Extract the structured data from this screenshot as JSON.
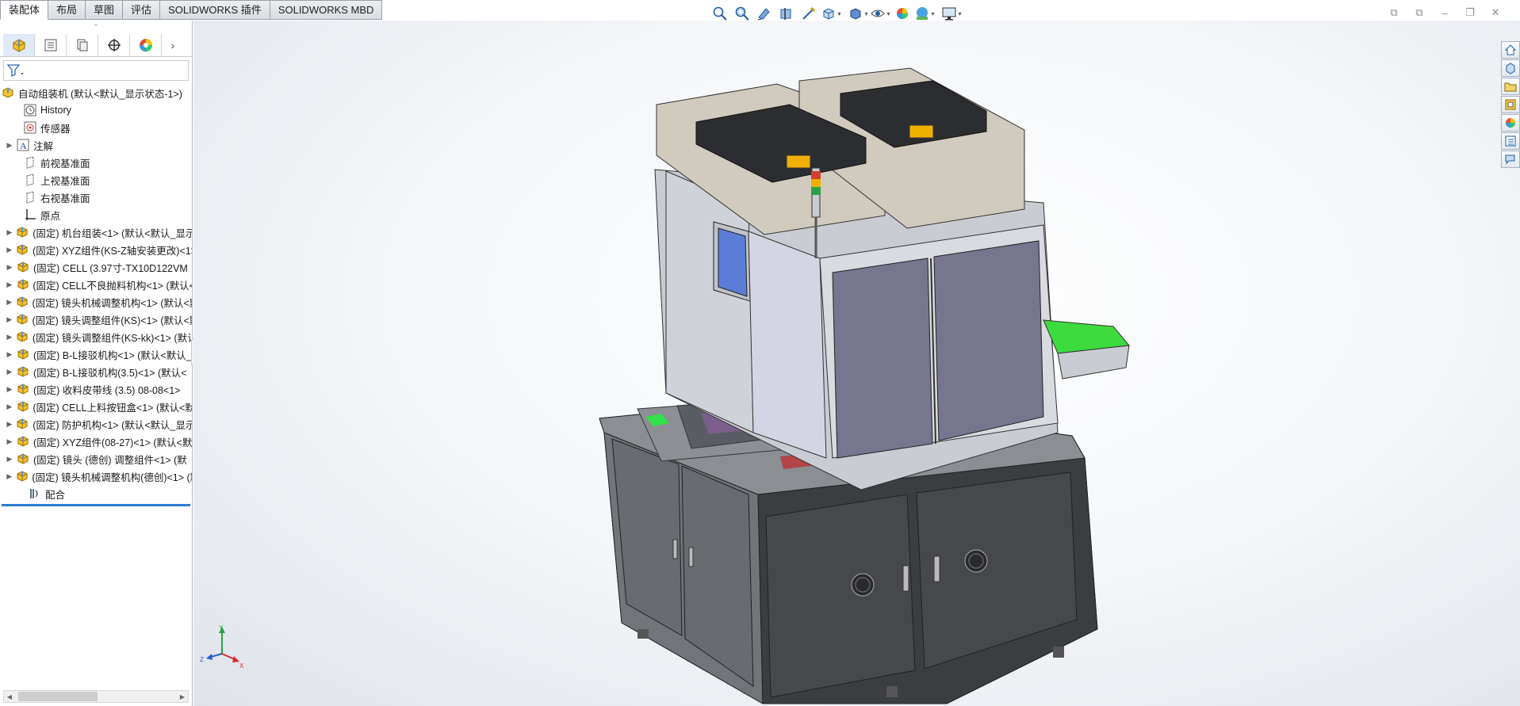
{
  "tabs": [
    "装配体",
    "布局",
    "草图",
    "评估",
    "SOLIDWORKS 插件",
    "SOLIDWORKS MBD"
  ],
  "active_tab_index": 0,
  "hud_icons": [
    "zoom-to-fit-icon",
    "zoom-to-area-icon",
    "previous-view-icon",
    "section-view-icon",
    "dynamic-annotation-icon",
    "view-orientation-icon",
    "display-style-icon",
    "hide-show-items-icon",
    "edit-appearance-icon",
    "apply-scene-icon",
    "view-settings-icon"
  ],
  "window_controls": [
    "tile-horizontal-icon",
    "tile-vertical-icon",
    "minimize-icon",
    "restore-icon",
    "close-icon"
  ],
  "panel_tabs": [
    "featuremanager-tab-icon",
    "propertymanager-tab-icon",
    "configurationmanager-tab-icon",
    "dimxpert-tab-icon",
    "displaymanager-tab-icon"
  ],
  "tree": {
    "root": "自动组装机 (默认<默认_显示状态-1>)",
    "history": "History",
    "sensors": "传感器",
    "annotations": "注解",
    "front_plane": "前视基准面",
    "top_plane": "上视基准面",
    "right_plane": "右视基准面",
    "origin": "原点",
    "components": [
      "(固定) 机台组装<1> (默认<默认_显示",
      "(固定) XYZ组件(KS-Z轴安装更改)<1>",
      "(固定) CELL (3.97寸-TX10D122VM",
      "(固定) CELL不良抛料机构<1> (默认<",
      "(固定) 镜头机械调整机构<1> (默认<默",
      "(固定) 镜头调整组件(KS)<1> (默认<默",
      "(固定) 镜头调整组件(KS-kk)<1> (默认",
      "(固定) B-L接驳机构<1> (默认<默认_",
      "(固定) B-L接驳机构(3.5)<1> (默认<",
      "(固定) 收料皮带线 (3.5) 08-08<1>",
      "(固定) CELL上料按钮盒<1> (默认<默",
      "(固定) 防护机构<1> (默认<默认_显示",
      "(固定) XYZ组件(08-27)<1> (默认<默",
      "(固定) 镜头 (德创) 调整组件<1> (默",
      "(固定) 镜头机械调整机构(德创)<1> (默"
    ],
    "mates": "配合"
  },
  "triad": {
    "x": "X",
    "y": "Y",
    "z": "Z"
  },
  "task_pane": [
    "solidworks-resources-icon",
    "design-library-icon",
    "file-explorer-icon",
    "view-palette-icon",
    "appearances-scenes-icon",
    "custom-properties-icon",
    "solidworks-forum-icon"
  ],
  "colors": {
    "selection_blue": "#2f7bd1",
    "machine_gray": "#6b6e72",
    "green_chute": "#22c832"
  }
}
